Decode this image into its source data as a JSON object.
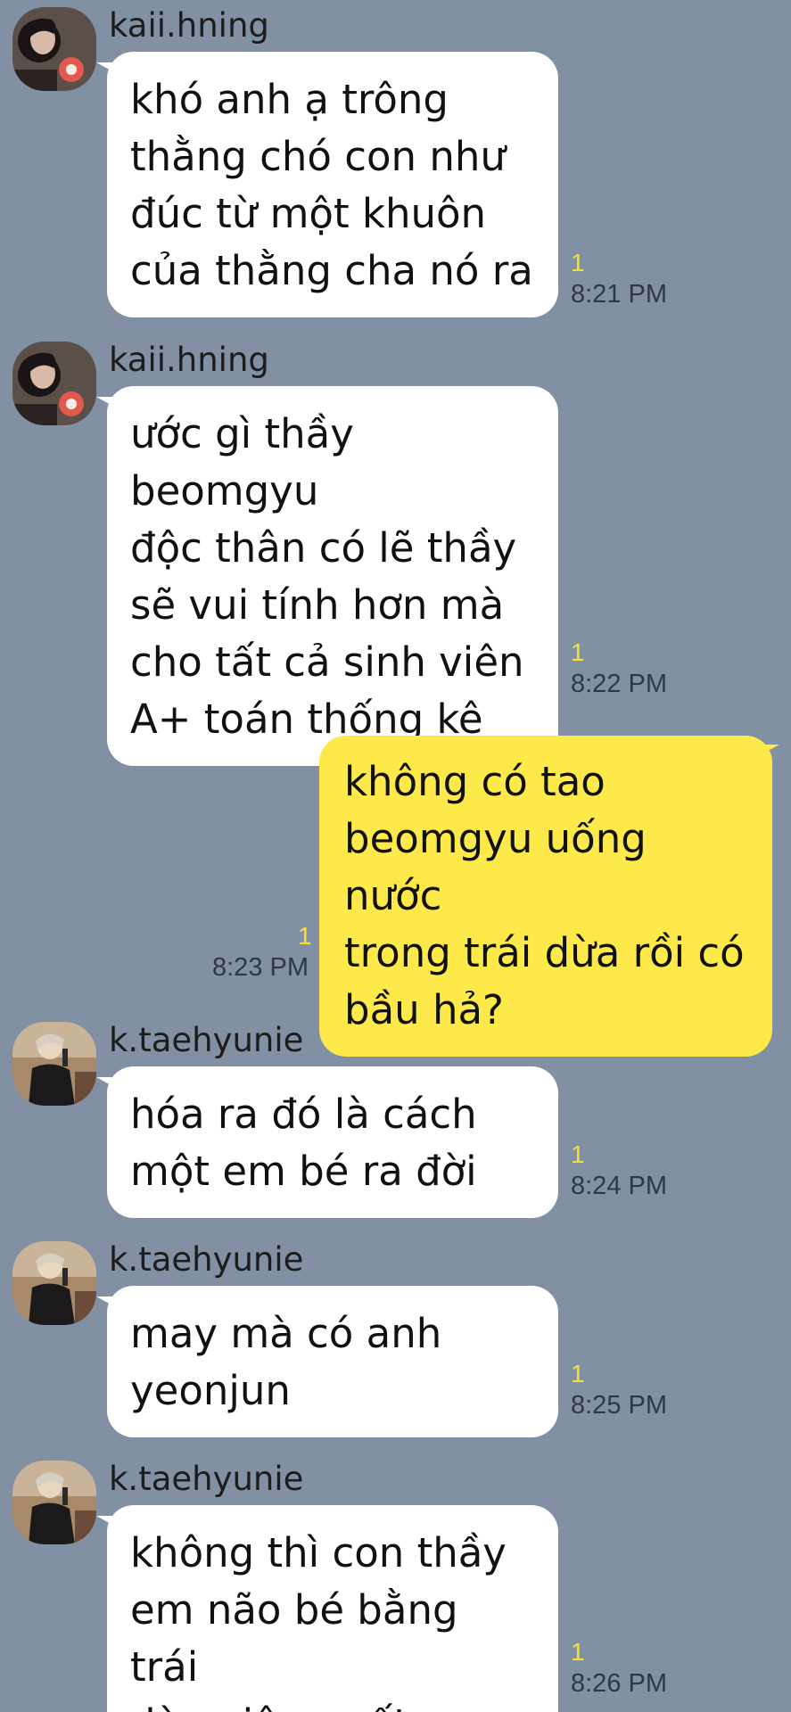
{
  "colors": {
    "background": "#8290a3",
    "incoming_bubble": "#ffffff",
    "outgoing_bubble": "#fde94a",
    "read_count": "#f5e12e"
  },
  "messages": [
    {
      "sender": "kaii.hning",
      "avatar": "avatar-kaii-hning",
      "text": "khó anh ạ trông\nthằng chó con như\nđúc từ một khuôn\ncủa thằng cha nó ra",
      "read": "1",
      "time": "8:21 PM"
    },
    {
      "sender": "kaii.hning",
      "avatar": "avatar-kaii-hning",
      "text": "ước gì thầy beomgyu\nđộc thân có lẽ thầy\nsẽ vui tính hơn mà\ncho tất cả sinh viên\nA+ toán thống kê",
      "read": "1",
      "time": "8:22 PM"
    },
    {
      "sender": "",
      "outgoing": true,
      "text": "không có tao\nbeomgyu uống nước\ntrong trái dừa rồi có\nbầu hả?",
      "read": "1",
      "time": "8:23 PM"
    },
    {
      "sender": "k.taehyunie",
      "avatar": "avatar-k-taehyunie",
      "text": "hóa ra đó là cách\nmột em bé ra đời",
      "read": "1",
      "time": "8:24 PM"
    },
    {
      "sender": "k.taehyunie",
      "avatar": "avatar-k-taehyunie",
      "text": "may mà có anh\nyeonjun",
      "read": "1",
      "time": "8:25 PM"
    },
    {
      "sender": "k.taehyunie",
      "avatar": "avatar-k-taehyunie",
      "text": "không thì con thầy\nem não bé bằng trái\ndừa xiêm mất",
      "read": "1",
      "time": "8:26 PM"
    }
  ]
}
